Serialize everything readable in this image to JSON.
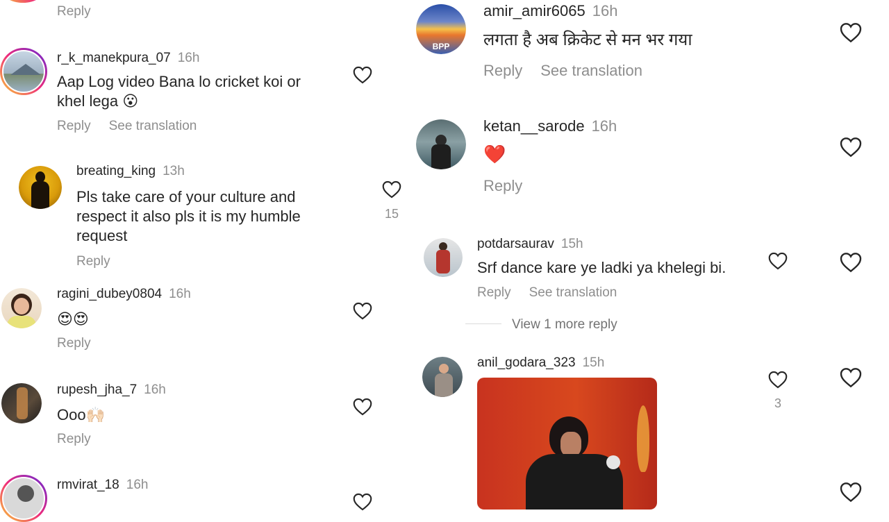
{
  "left": {
    "top_reply": "Reply",
    "comments": [
      {
        "user": "r_k_manekpura_07",
        "time": "16h",
        "text_line1": "Aap Log video Bana lo cricket koi or",
        "text_line2": "khel lega",
        "emoji": "😮",
        "reply": "Reply",
        "translate": "See translation"
      },
      {
        "user": "breating_king",
        "time": "13h",
        "text_line1": "Pls take care of  your culture and",
        "text_line2": "respect it also pls it is my humble",
        "text_line3": "request",
        "reply": "Reply",
        "likes": "15"
      },
      {
        "user": "ragini_dubey0804",
        "time": "16h",
        "emoji": "😍😍",
        "reply": "Reply"
      },
      {
        "user": "rupesh_jha_7",
        "time": "16h",
        "text": "Ooo",
        "emoji": "🙌🏻",
        "reply": "Reply"
      },
      {
        "user": "rmvirat_18",
        "time": "16h"
      }
    ]
  },
  "right": {
    "comments": [
      {
        "user": "amir_amir6065",
        "time": "16h",
        "text": "लगता है अब क्रिकेट से मन भर गया",
        "reply": "Reply",
        "translate": "See translation",
        "avatar_text": "BPP"
      },
      {
        "user": "ketan__sarode",
        "time": "16h",
        "emoji": "❤️",
        "reply": "Reply"
      },
      {
        "user": "potdarsaurav",
        "time": "15h",
        "text": "Srf dance kare ye ladki ya khelegi bi.",
        "reply": "Reply",
        "translate": "See translation",
        "view_more": "View 1 more reply"
      },
      {
        "user": "anil_godara_323",
        "time": "15h",
        "likes": "3"
      }
    ]
  },
  "colors": {
    "text": "#262626",
    "muted": "#8e8e8e",
    "heart_red": "#ed4956"
  },
  "icons": [
    "heart-outline-icon",
    "heart-emoji"
  ]
}
